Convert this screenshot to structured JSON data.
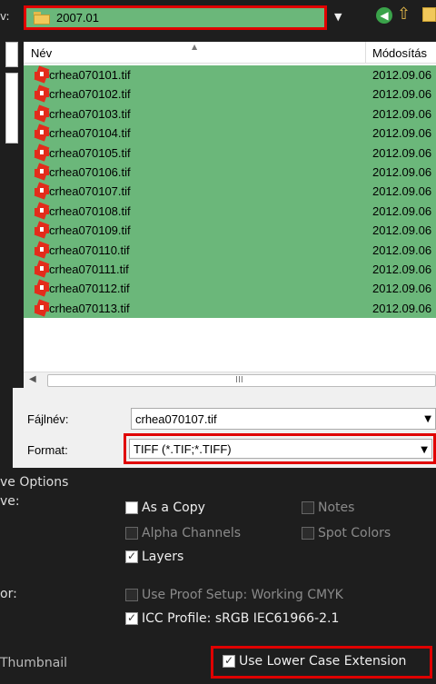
{
  "topbar": {
    "look_label": "v:",
    "folder_name": "2007.01",
    "icons": [
      "folder-icon",
      "back-icon",
      "up-folder-icon",
      "new-folder-icon"
    ]
  },
  "file_list": {
    "col_name": "Név",
    "col_date": "Módosítás",
    "rows": [
      {
        "name": "crhea070101.tif",
        "date": "2012.09.06"
      },
      {
        "name": "crhea070102.tif",
        "date": "2012.09.06"
      },
      {
        "name": "crhea070103.tif",
        "date": "2012.09.06"
      },
      {
        "name": "crhea070104.tif",
        "date": "2012.09.06"
      },
      {
        "name": "crhea070105.tif",
        "date": "2012.09.06"
      },
      {
        "name": "crhea070106.tif",
        "date": "2012.09.06"
      },
      {
        "name": "crhea070107.tif",
        "date": "2012.09.06"
      },
      {
        "name": "crhea070108.tif",
        "date": "2012.09.06"
      },
      {
        "name": "crhea070109.tif",
        "date": "2012.09.06"
      },
      {
        "name": "crhea070110.tif",
        "date": "2012.09.06"
      },
      {
        "name": "crhea070111.tif",
        "date": "2012.09.06"
      },
      {
        "name": "crhea070112.tif",
        "date": "2012.09.06"
      },
      {
        "name": "crhea070113.tif",
        "date": "2012.09.06"
      }
    ],
    "scroll_grip": "III"
  },
  "form": {
    "filename_label": "Fájlnév:",
    "filename_value": "crhea070107.tif",
    "format_label": "Format:",
    "format_value": "TIFF (*.TIF;*.TIFF)"
  },
  "save_options": {
    "heading": "ve Options",
    "save_label": "ve:",
    "as_a_copy": "As a Copy",
    "notes": "Notes",
    "alpha_channels": "Alpha Channels",
    "spot_colors": "Spot Colors",
    "layers": "Layers",
    "color_label": "or:",
    "use_proof_setup": "Use Proof Setup:  Working CMYK",
    "icc_profile": "ICC Profile:  sRGB IEC61966-2.1",
    "thumbnail": "Thumbnail",
    "lower_case": "Use Lower Case Extension"
  },
  "colors": {
    "selection_green": "#6bb77a",
    "highlight_red": "#e00000",
    "dark_bg": "#1e1e1e"
  }
}
